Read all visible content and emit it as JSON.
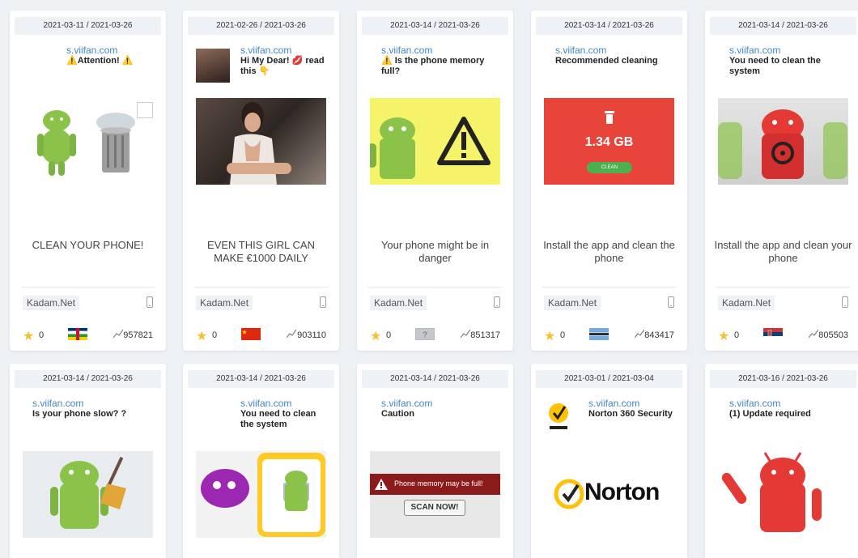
{
  "cards": [
    {
      "dates": "2021-03-11 / 2021-03-26",
      "domain": "s.viifan.com",
      "title": "⚠️Attention! ⚠️",
      "tagline": "CLEAN YOUR PHONE!",
      "network": "Kadam.Net",
      "stars": "0",
      "count": "957821",
      "flag": "central-african-republic"
    },
    {
      "dates": "2021-02-26 / 2021-03-26",
      "domain": "s.viifan.com",
      "title": "Hi My Dear! 💋 read this 👇",
      "tagline": "EVEN THIS GIRL CAN MAKE €1000 DAILY",
      "network": "Kadam.Net",
      "stars": "0",
      "count": "903110",
      "flag": "china"
    },
    {
      "dates": "2021-03-14 / 2021-03-26",
      "domain": "s.viifan.com",
      "title": "⚠️ Is the phone memory full?",
      "tagline": "Your phone might be in danger",
      "network": "Kadam.Net",
      "stars": "0",
      "count": "851317",
      "flag": "unknown"
    },
    {
      "dates": "2021-03-14 / 2021-03-26",
      "domain": "s.viifan.com",
      "title": "Recommended cleaning",
      "tagline": "Install the app and clean the phone",
      "network": "Kadam.Net",
      "stars": "0",
      "count": "843417",
      "flag": "botswana",
      "img_size": "1.34 GB",
      "img_button": "CLEAN"
    },
    {
      "dates": "2021-03-14 / 2021-03-26",
      "domain": "s.viifan.com",
      "title": "You need to clean the system",
      "tagline": "Install the app and clean your phone",
      "network": "Kadam.Net",
      "stars": "0",
      "count": "805503",
      "flag": "serbia"
    },
    {
      "dates": "2021-03-14 / 2021-03-26",
      "domain": "s.viifan.com",
      "title": "Is your phone slow? ?"
    },
    {
      "dates": "2021-03-14 / 2021-03-26",
      "domain": "s.viifan.com",
      "title": "You need to clean the system"
    },
    {
      "dates": "2021-03-14 / 2021-03-26",
      "domain": "s.viifan.com",
      "title": "Caution",
      "img_text": "Phone memory may be full!",
      "img_button": "SCAN NOW!"
    },
    {
      "dates": "2021-03-01 / 2021-03-04",
      "domain": "s.viifan.com",
      "title": "Norton 360 Security",
      "logo_text": "Norton"
    },
    {
      "dates": "2021-03-16 / 2021-03-26",
      "domain": "s.viifan.com",
      "title": "(1) Update required"
    }
  ],
  "colors": {
    "accent": "#3f86c6",
    "star": "#f2c232",
    "android_green": "#8bc34a",
    "alert_red": "#e8443a"
  }
}
